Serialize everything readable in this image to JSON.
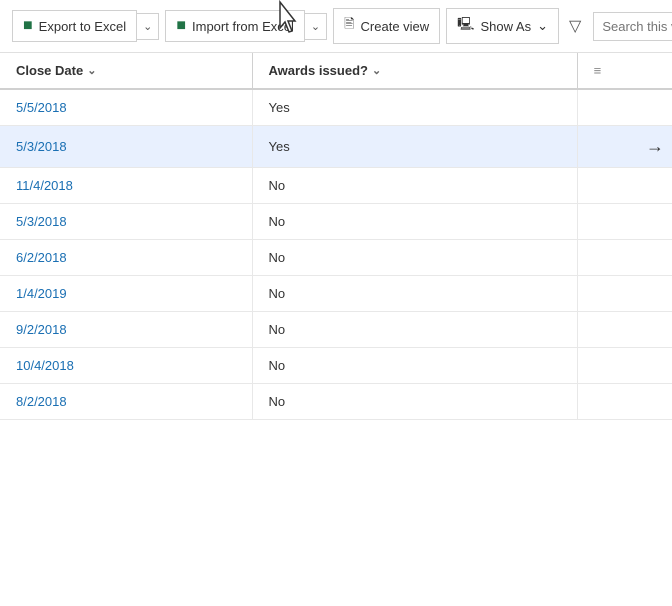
{
  "toolbar": {
    "export_label": "Export to Excel",
    "import_label": "Import from Excel",
    "create_view_label": "Create view",
    "show_as_label": "Show As",
    "search_placeholder": "Search this view"
  },
  "columns": [
    {
      "id": "close_date",
      "label": "Close Date",
      "sort": "asc"
    },
    {
      "id": "awards_issued",
      "label": "Awards issued?",
      "sort": "asc"
    }
  ],
  "rows": [
    {
      "close_date": "5/5/2018",
      "awards_issued": "Yes",
      "highlighted": false
    },
    {
      "close_date": "5/3/2018",
      "awards_issued": "Yes",
      "highlighted": true
    },
    {
      "close_date": "11/4/2018",
      "awards_issued": "No",
      "highlighted": false
    },
    {
      "close_date": "5/3/2018",
      "awards_issued": "No",
      "highlighted": false
    },
    {
      "close_date": "6/2/2018",
      "awards_issued": "No",
      "highlighted": false
    },
    {
      "close_date": "1/4/2019",
      "awards_issued": "No",
      "highlighted": false
    },
    {
      "close_date": "9/2/2018",
      "awards_issued": "No",
      "highlighted": false
    },
    {
      "close_date": "10/4/2018",
      "awards_issued": "No",
      "highlighted": false
    },
    {
      "close_date": "8/2/2018",
      "awards_issued": "No",
      "highlighted": false
    }
  ]
}
